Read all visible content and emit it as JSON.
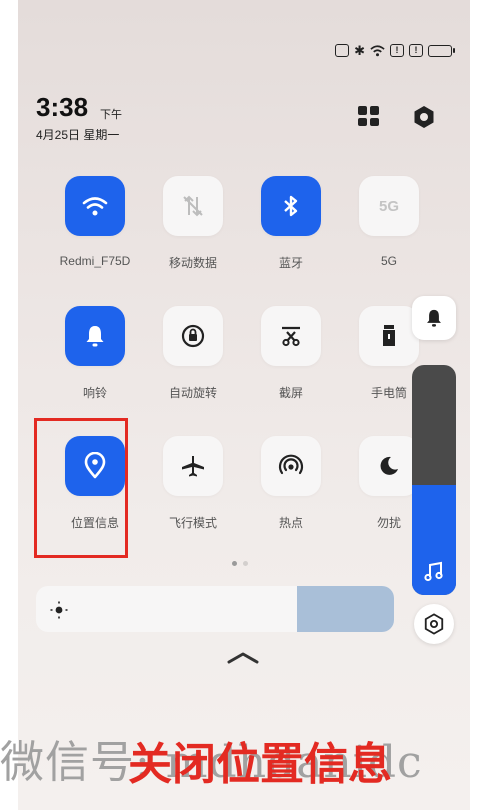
{
  "status_bar": {
    "icons": [
      "cast-icon",
      "bluetooth-icon",
      "wifi-icon",
      "alert-icon",
      "alert-icon",
      "battery-icon"
    ]
  },
  "header": {
    "time": "3:38",
    "ampm": "下午",
    "date": "4月25日 星期一"
  },
  "tiles": [
    {
      "label": "Redmi_F75D",
      "icon": "wifi-icon",
      "active": true
    },
    {
      "label": "移动数据",
      "icon": "mobile-data-icon",
      "active": false
    },
    {
      "label": "蓝牙",
      "icon": "bluetooth-icon",
      "active": true
    },
    {
      "label": "5G",
      "icon": "5g-icon",
      "active": false
    },
    {
      "label": "响铃",
      "icon": "bell-icon",
      "active": true
    },
    {
      "label": "自动旋转",
      "icon": "auto-rotate-icon",
      "active": false
    },
    {
      "label": "截屏",
      "icon": "screenshot-icon",
      "active": false
    },
    {
      "label": "手电筒",
      "icon": "flashlight-icon",
      "active": false
    },
    {
      "label": "位置信息",
      "icon": "location-icon",
      "active": true
    },
    {
      "label": "飞行模式",
      "icon": "airplane-icon",
      "active": false
    },
    {
      "label": "热点",
      "icon": "hotspot-icon",
      "active": false
    },
    {
      "label": "勿扰",
      "icon": "moon-icon",
      "active": false
    }
  ],
  "five_g_text": "5G",
  "page_dots": {
    "count": 2,
    "current": 1
  },
  "brightness": {
    "level": 0.73
  },
  "volume": {
    "level": 0.48
  },
  "watermark": "微信号: mdhdanidc",
  "caption": "关闭位置信息",
  "colors": {
    "accent": "#1e63ec",
    "highlight": "#e32a22"
  }
}
